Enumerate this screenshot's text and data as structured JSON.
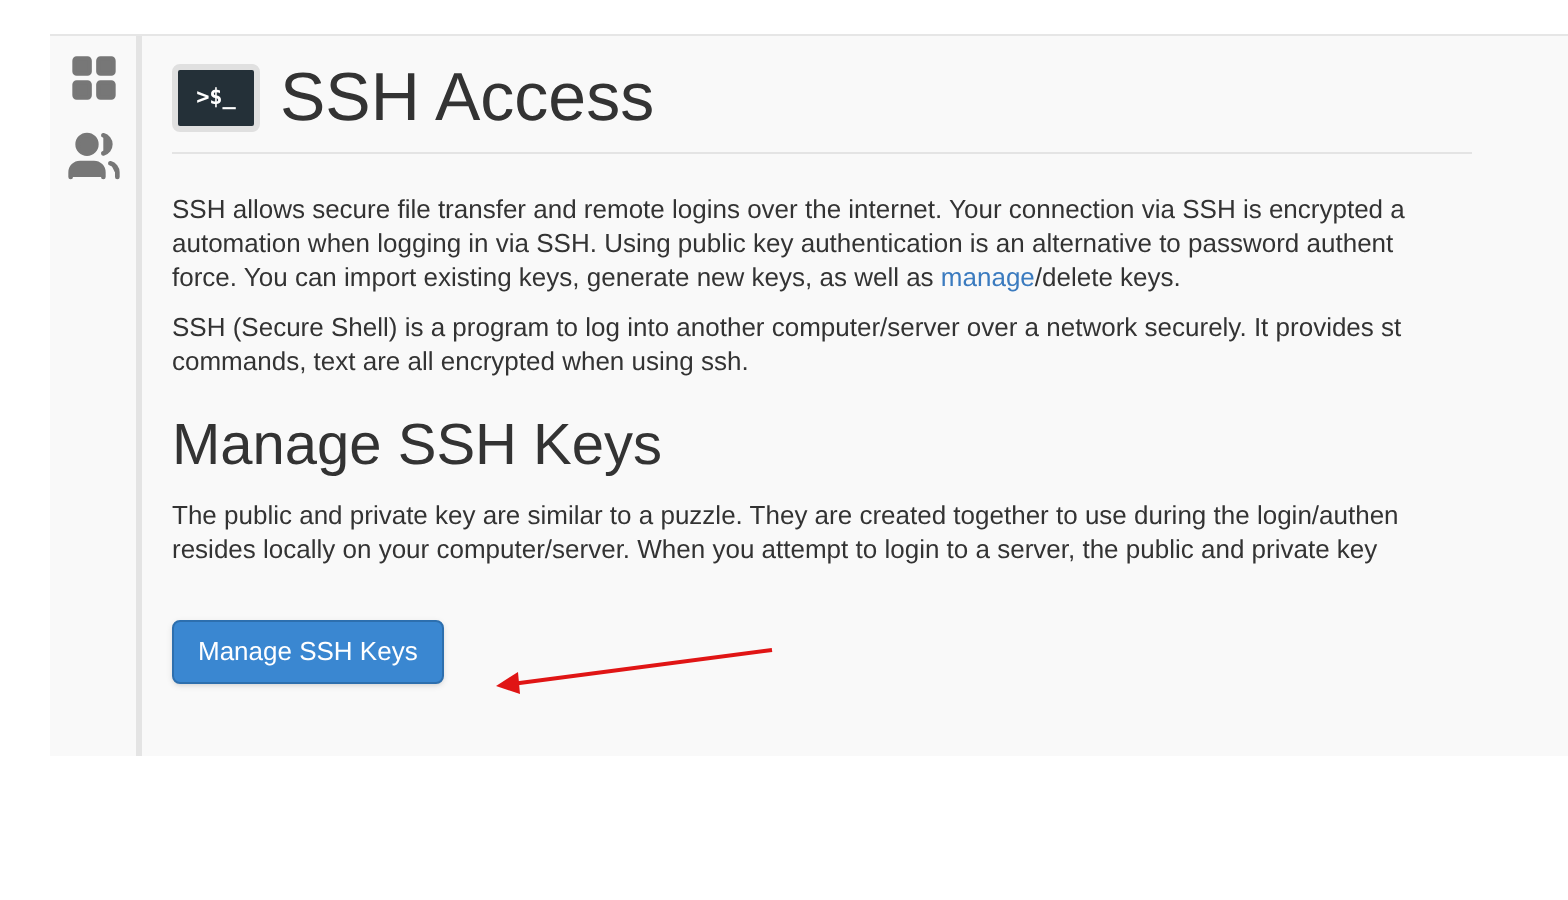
{
  "title": "SSH Access",
  "terminal_icon_text": ">$_",
  "intro": {
    "lines": [
      "SSH allows secure file transfer and remote logins over the internet. Your connection via SSH is encrypted a",
      "automation when logging in via SSH. Using public key authentication is an alternative to password authent"
    ],
    "last_line": {
      "before": "force. You can import existing keys, generate new keys, as well as ",
      "link": "manage",
      "after": "/delete keys."
    }
  },
  "about": {
    "lines": [
      "SSH (Secure Shell) is a program to log into another computer/server over a network securely. It provides st",
      "commands, text are all encrypted when using ssh."
    ]
  },
  "section": {
    "heading": "Manage SSH Keys",
    "lines": [
      "The public and private key are similar to a puzzle. They are created together to use during the login/authen",
      "resides locally on your computer/server. When you attempt to login to a server, the public and private key"
    ],
    "button": "Manage SSH Keys"
  }
}
